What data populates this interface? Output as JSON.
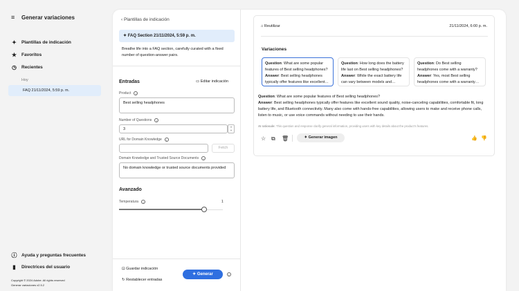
{
  "sidebar": {
    "title": "Generar variaciones",
    "nav": [
      {
        "label": "Plantillas de indicación",
        "icon": "sparkle-icon"
      },
      {
        "label": "Favoritos",
        "icon": "star-icon"
      },
      {
        "label": "Recientes",
        "icon": "clock-icon"
      }
    ],
    "recent_group": "Hoy",
    "recent_item": "FAQ 21/11/2024, 5:59 p. m.",
    "help": "Ayuda y preguntas frecuentes",
    "guidelines": "Directrices del usuario",
    "copyright": "Copyright © 2024 Adobe. All rights reserved",
    "version": "Generar variaciones v2.5.2"
  },
  "template": {
    "back": "Plantillas de indicación",
    "title": "FAQ Section 21/11/2024, 5:59 p. m.",
    "description": "Breathe life into a FAQ section, carefully curated with a fixed number of question-answer pairs."
  },
  "inputs": {
    "heading": "Entradas",
    "edit": "Editar indicación",
    "product_label": "Product",
    "product_value": "Best selling headphones",
    "num_label": "Number of Questions",
    "num_value": "3",
    "url_label": "URL for Domain Knowledge",
    "url_value": "",
    "fetch": "Fetch",
    "docs_label": "Domain Knowledge and Trusted Source Documents",
    "docs_value": "No domain knowledge or trusted source documents provided"
  },
  "advanced": {
    "heading": "Avanzado",
    "temp_label": "Temperatura",
    "temp_value": "1",
    "temp_fraction": 0.82
  },
  "footer": {
    "save": "Guardar indicación",
    "reset": "Restablecer entradas",
    "generate": "Generar"
  },
  "result": {
    "reuse": "Reutilizar",
    "timestamp": "21/11/2024, 6:00 p. m.",
    "variations_heading": "Variaciones",
    "q_label": "Question",
    "a_label": "Answer",
    "cards": [
      {
        "q": "What are some popular features of Best selling headphones?",
        "a": "Best selling headphones typically offer features like excellent…"
      },
      {
        "q": "How long does the battery life last on Best selling headphones?",
        "a": "While the exact battery life can vary between models and…"
      },
      {
        "q": "Do Best selling headphones come with a warranty?",
        "a": "Yes, most Best selling headphones come with a warranty…"
      }
    ],
    "detail_q": "What are some popular features of Best selling headphones?",
    "detail_a": "Best selling headphones typically offer features like excellent sound quality, noise-canceling capabilities, comfortable fit, long battery life, and Bluetooth connectivity. Many also come with hands-free capabilities, allowing users to make and receive phone calls, listen to music, or use voice commands without needing to use their hands.",
    "rationale_label": "AI rationale:",
    "rationale": "This question and response clarify general information, providing users with key details about the product's features.",
    "gen_image": "Generar imagen"
  }
}
